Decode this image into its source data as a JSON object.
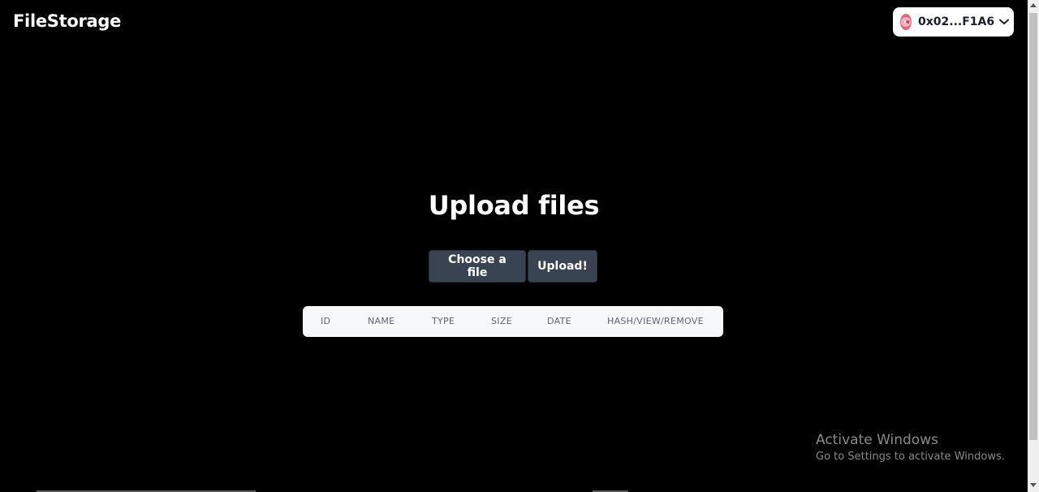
{
  "header": {
    "brand": "FileStorage",
    "wallet": {
      "address": "0x02...F1A6",
      "avatar_icon": "wallet-avatar-icon",
      "chevron_icon": "chevron-down-icon",
      "avatar_color": "#e8637a"
    }
  },
  "main": {
    "title": "Upload files",
    "choose_label": "Choose a file",
    "upload_label": "Upload!"
  },
  "table": {
    "columns": [
      "ID",
      "NAME",
      "TYPE",
      "SIZE",
      "DATE",
      "HASH/VIEW/REMOVE"
    ]
  },
  "watermark": {
    "title": "Activate Windows",
    "subtitle": "Go to Settings to activate Windows."
  },
  "colors": {
    "background": "#000000",
    "button_bg": "#3a4352",
    "table_bg": "#f7f8fa",
    "table_header_text": "#5a6473"
  }
}
